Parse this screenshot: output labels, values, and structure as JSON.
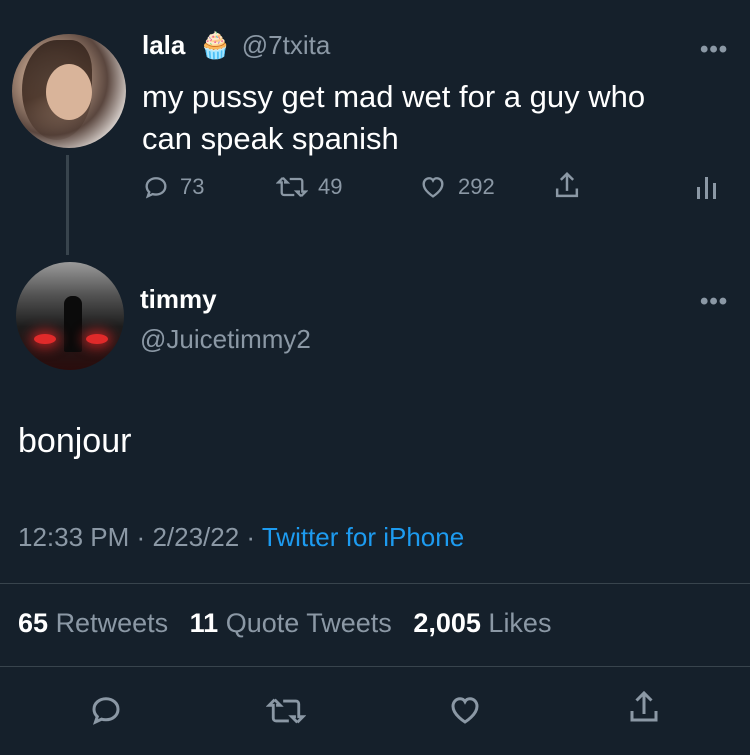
{
  "parent_tweet": {
    "display_name": "lala",
    "badge_emoji": "🧁",
    "handle": "@7txita",
    "text": "my pussy get mad wet for a guy who can speak spanish",
    "more_label": "•••",
    "replies": "73",
    "retweets": "49",
    "likes": "292"
  },
  "reply_tweet": {
    "display_name": "timmy",
    "handle": "@Juicetimmy2",
    "more_label": "•••",
    "text": "bonjour",
    "time": "12:33 PM",
    "separator": "·",
    "date": "2/23/22",
    "source": "Twitter for iPhone"
  },
  "stats": {
    "retweets_count": "65",
    "retweets_label": "Retweets",
    "quote_count": "11",
    "quote_label": "Quote Tweets",
    "likes_count": "2,005",
    "likes_label": "Likes"
  },
  "colors": {
    "background": "#15202b",
    "secondary_text": "#8b98a5",
    "link": "#1d9bf0",
    "divider": "#38444d"
  },
  "icons": [
    "reply-icon",
    "retweet-icon",
    "like-icon",
    "share-icon",
    "analytics-icon"
  ]
}
